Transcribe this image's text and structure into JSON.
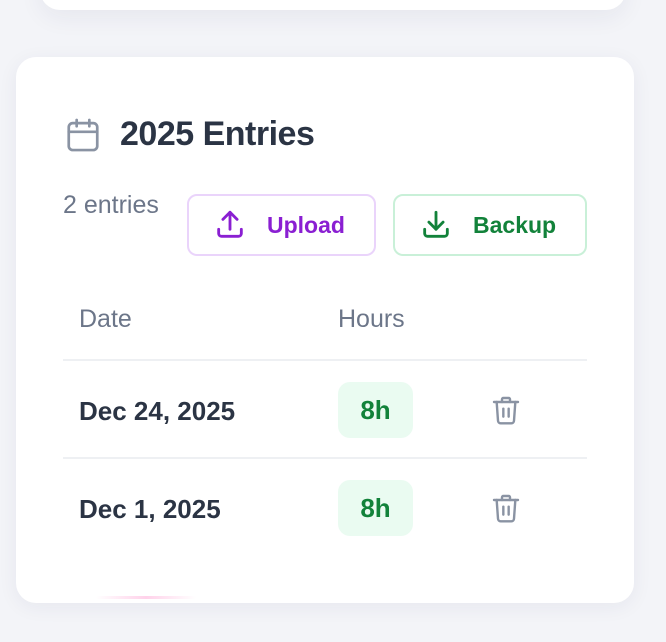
{
  "header": {
    "title": "2025 Entries",
    "icon": "calendar-icon"
  },
  "summary": {
    "count_text": "2 entries"
  },
  "actions": {
    "upload": {
      "label": "Upload",
      "icon": "upload-icon",
      "color": "#8a1fd2"
    },
    "backup": {
      "label": "Backup",
      "icon": "download-icon",
      "color": "#12823a"
    }
  },
  "table": {
    "columns": [
      "Date",
      "Hours"
    ],
    "rows": [
      {
        "date": "Dec 24, 2025",
        "hours": "8h"
      },
      {
        "date": "Dec 1, 2025",
        "hours": "8h"
      }
    ]
  },
  "colors": {
    "accent_green": "#12823a",
    "badge_bg": "#eafbf1",
    "text_dark": "#2b3444",
    "text_muted": "#6c7689"
  }
}
